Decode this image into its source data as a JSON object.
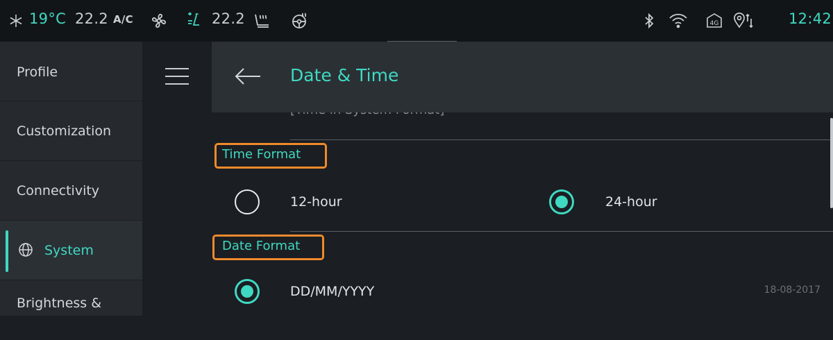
{
  "status_bar": {
    "temperature": "19°C",
    "fan_setting": "22.2",
    "ac_label": "A/C",
    "seat_setting": "22.2",
    "time": "12:42",
    "icons": [
      "snowflake-icon",
      "fan-icon",
      "seat-airflow-icon",
      "seat-heat-icon",
      "steering-heat-icon",
      "bluetooth-icon",
      "wifi-icon",
      "4g-icon",
      "location-icon"
    ],
    "accent_color": "#3fd9c2"
  },
  "sidebar": {
    "items": [
      {
        "label": "Profile"
      },
      {
        "label": "Customization"
      },
      {
        "label": "Connectivity"
      },
      {
        "label": "System",
        "icon": "globe-icon",
        "active": true
      },
      {
        "label": "Brightness &"
      }
    ]
  },
  "header": {
    "title": "Date & Time"
  },
  "content": {
    "peek_text": "[Time in System Format]",
    "time_format": {
      "label": "Time Format",
      "options": [
        {
          "label": "12-hour",
          "selected": false
        },
        {
          "label": "24-hour",
          "selected": true
        }
      ]
    },
    "date_format": {
      "label": "Date Format",
      "options": [
        {
          "label": "DD/MM/YYYY",
          "selected": true,
          "preview": "18-08-2017"
        }
      ]
    }
  },
  "colors": {
    "accent": "#3fd9c2",
    "highlight": "#f08a2c",
    "background": "#1b1e22",
    "sidebar": "#262a2f"
  }
}
